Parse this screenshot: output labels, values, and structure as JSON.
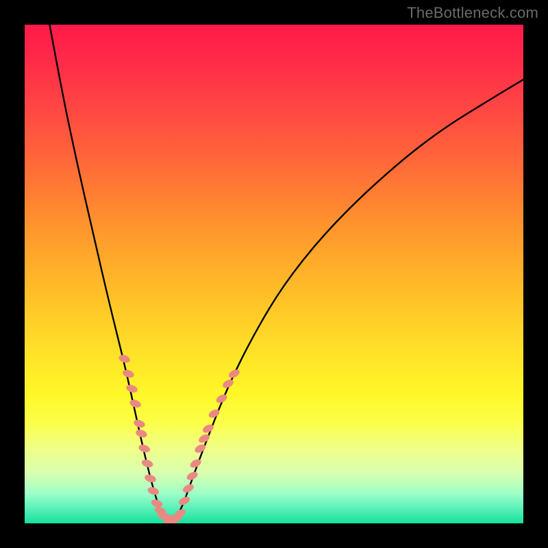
{
  "watermark": "TheBottleneck.com",
  "gradient_colors": {
    "top": "#ff1a4b",
    "mid_upper": "#ff9a2c",
    "mid": "#ffe228",
    "mid_lower": "#fbff4a",
    "bottom": "#14e29c"
  },
  "chart_data": {
    "type": "line",
    "title": "",
    "xlabel": "",
    "ylabel": "",
    "xlim": [
      0,
      100
    ],
    "ylim": [
      0,
      100
    ],
    "series": [
      {
        "name": "bottleneck-curve",
        "x": [
          5,
          8,
          11,
          14,
          17,
          20,
          22,
          24,
          25.5,
          27,
          28,
          29,
          30,
          31.5,
          34,
          37,
          41,
          46,
          52,
          60,
          70,
          82,
          95,
          100
        ],
        "y": [
          100,
          84,
          70,
          57,
          44,
          32,
          23,
          14,
          8,
          3,
          0.8,
          0.5,
          0.8,
          3,
          10,
          18,
          28,
          38,
          48,
          58,
          68,
          78,
          86,
          89
        ]
      }
    ],
    "highlight_beads": {
      "name": "dotted-pink-markers",
      "color": "#e98a82",
      "points": [
        {
          "x": 20.0,
          "y": 33
        },
        {
          "x": 20.8,
          "y": 30
        },
        {
          "x": 21.5,
          "y": 27
        },
        {
          "x": 22.2,
          "y": 24
        },
        {
          "x": 23.0,
          "y": 20
        },
        {
          "x": 23.4,
          "y": 18
        },
        {
          "x": 24.0,
          "y": 15
        },
        {
          "x": 24.6,
          "y": 12
        },
        {
          "x": 25.2,
          "y": 9
        },
        {
          "x": 25.8,
          "y": 6.5
        },
        {
          "x": 26.5,
          "y": 4
        },
        {
          "x": 27.2,
          "y": 2.5
        },
        {
          "x": 27.8,
          "y": 1.5
        },
        {
          "x": 28.5,
          "y": 0.8
        },
        {
          "x": 29.0,
          "y": 0.5
        },
        {
          "x": 29.7,
          "y": 0.6
        },
        {
          "x": 30.5,
          "y": 1.0
        },
        {
          "x": 31.2,
          "y": 2.0
        },
        {
          "x": 32.0,
          "y": 4.5
        },
        {
          "x": 32.8,
          "y": 7
        },
        {
          "x": 33.6,
          "y": 9.5
        },
        {
          "x": 34.3,
          "y": 12
        },
        {
          "x": 35.2,
          "y": 15
        },
        {
          "x": 36.0,
          "y": 17
        },
        {
          "x": 36.8,
          "y": 19
        },
        {
          "x": 38.0,
          "y": 22
        },
        {
          "x": 39.5,
          "y": 25
        },
        {
          "x": 40.8,
          "y": 28
        },
        {
          "x": 42.0,
          "y": 30
        }
      ]
    }
  }
}
